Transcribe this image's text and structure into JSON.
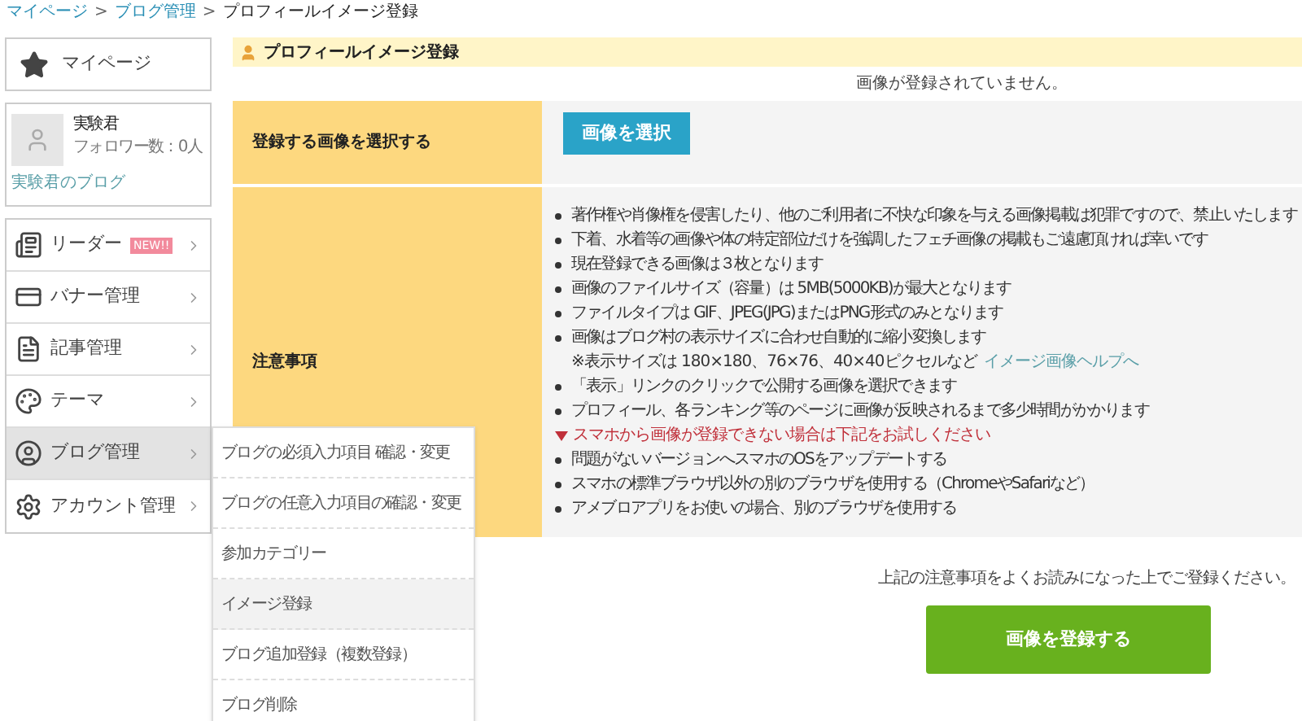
{
  "breadcrumb": [
    {
      "label": "マイページ",
      "kind": "link",
      "separator": ">"
    },
    {
      "label": "ブログ管理",
      "kind": "link",
      "separator": ">"
    },
    {
      "label": "プロフィールイメージ登録",
      "kind": "current"
    }
  ],
  "sidebar": {
    "mypage": {
      "label": "マイページ"
    },
    "profile": {
      "name": "実験君",
      "followers": "フォロワー数：0人",
      "blog_link": "実験君のブログ"
    },
    "menu": [
      {
        "label": "リーダー",
        "badge": "NEW!!",
        "selected": false
      },
      {
        "label": "バナー管理",
        "selected": false
      },
      {
        "label": "記事管理",
        "selected": false
      },
      {
        "label": "テーマ",
        "selected": false
      },
      {
        "label": "ブログ管理",
        "selected": true
      },
      {
        "label": "アカウント管理",
        "selected": false
      }
    ],
    "submenu": [
      {
        "label": "ブログの必須入力項目 確認・変更",
        "selected": false
      },
      {
        "label": "ブログの任意入力項目の確認・変更",
        "selected": false
      },
      {
        "label": "参加カテゴリー",
        "selected": false
      },
      {
        "label": "イメージ登録",
        "selected": true
      },
      {
        "label": "ブログ追加登録（複数登録）",
        "selected": false
      },
      {
        "label": "ブログ削除",
        "selected": false
      }
    ]
  },
  "page_title": "プロフィールイメージ登録",
  "status": "画像が登録されていません。",
  "form": {
    "select_label": "登録する画像を選択する",
    "select_button": "画像を選択",
    "notes_label": "注意事項",
    "notes": [
      {
        "kind": "bullet",
        "text": "著作権や肖像権を侵害したり、他のご利用者に不快な印象を与える画像掲載は犯罪ですので、禁止いたします"
      },
      {
        "kind": "bullet",
        "text": "下着、水着等の画像や体の特定部位だけを強調したフェチ画像の掲載もご遠慮頂ければ幸いです"
      },
      {
        "kind": "bullet",
        "text": "現在登録できる画像は３枚となります"
      },
      {
        "kind": "bullet",
        "text": "画像のファイルサイズ（容量）は 5MB(5000KB)が最大となります"
      },
      {
        "kind": "bullet",
        "text": "ファイルタイプは GIF、JPEG(JPG)またはPNG形式のみとなります"
      },
      {
        "kind": "bullet",
        "text": "画像はブログ村の表示サイズに合わせ自動的に縮小変換します"
      },
      {
        "kind": "sub",
        "text": "※表示サイズは 180×180、76×76、40×40ピクセルなど",
        "link": "イメージ画像ヘルプへ"
      },
      {
        "kind": "bullet",
        "text": "「表示」リンクのクリックで公開する画像を選択できます"
      },
      {
        "kind": "bullet",
        "text": "プロフィール、各ランキング等のページに画像が反映されるまで多少時間がかかります"
      },
      {
        "kind": "warning",
        "text": "スマホから画像が登録できない場合は下記をお試しください"
      },
      {
        "kind": "bullet",
        "text": "問題がないバージョンへスマホのOSをアップデートする"
      },
      {
        "kind": "bullet",
        "text": "スマホの標準ブラウザ以外の別のブラウザを使用する（ChromeやSafariなど）"
      },
      {
        "kind": "bullet",
        "text": "アメブロアプリをお使いの場合、別のブラウザを使用する"
      }
    ]
  },
  "confirm_text": "上記の注意事項をよくお読みになった上でご登録ください。",
  "submit_button": "画像を登録する"
}
